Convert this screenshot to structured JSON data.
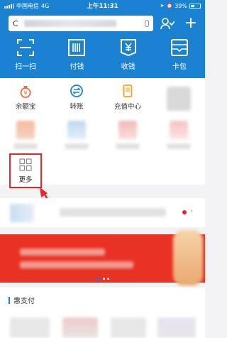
{
  "status": {
    "carrier": "中国电信",
    "network": "4G",
    "time": "上午11:31",
    "battery": "39%"
  },
  "search": {
    "query": "C"
  },
  "top_actions": [
    {
      "label": "扫一扫",
      "icon": "scan-icon"
    },
    {
      "label": "付钱",
      "icon": "barcode-icon"
    },
    {
      "label": "收钱",
      "icon": "yuan-receive-icon"
    },
    {
      "label": "卡包",
      "icon": "card-wallet-icon"
    }
  ],
  "services": [
    {
      "label": "余额宝",
      "icon": "moneybag-icon",
      "color": "#ef6a3c"
    },
    {
      "label": "转账",
      "icon": "transfer-icon",
      "color": "#1b82d2"
    },
    {
      "label": "充值中心",
      "icon": "phone-recharge-icon",
      "color": "#f4a31a"
    }
  ],
  "more": {
    "label": "更多"
  },
  "section": {
    "title": "惠支付"
  },
  "colors": {
    "brand": "#1b82d2",
    "highlight": "#e8262a",
    "banner": "#e83224"
  }
}
